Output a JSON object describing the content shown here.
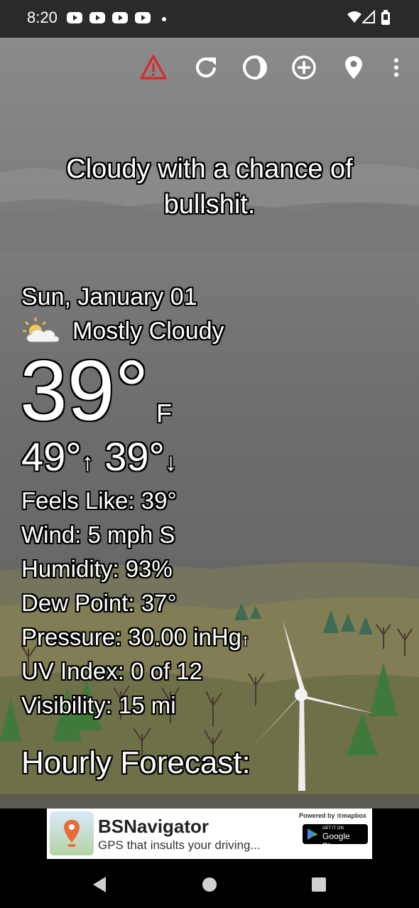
{
  "status_bar": {
    "time": "8:20",
    "notifications": [
      "youtube-icon",
      "youtube-icon",
      "youtube-icon",
      "youtube-icon"
    ],
    "system_icons": [
      "wifi-icon",
      "signal-icon",
      "battery-icon"
    ]
  },
  "toolbar": {
    "icons": [
      "warning-icon",
      "refresh-icon",
      "theme-icon",
      "add-location-icon",
      "location-pin-icon",
      "more-vert-icon"
    ],
    "warning_color": "#d32f2f"
  },
  "weather": {
    "tagline": "Cloudy with a chance of bullshit.",
    "date": "Sun, January 01",
    "condition": "Mostly Cloudy",
    "condition_icon": "partly-cloudy-icon",
    "temperature": "39°",
    "unit": "F",
    "high": "49°",
    "high_arrow": "↑",
    "low": "39°",
    "low_arrow": "↓",
    "details": {
      "feels_like": "Feels Like:  39°",
      "wind": "Wind:  5 mph S",
      "humidity": "Humidity:  93%",
      "dew_point": "Dew Point:  37°",
      "pressure": "Pressure:  30.00 inHg",
      "pressure_arrow": "↑",
      "uv_index": "UV Index:  0 of 12",
      "visibility": "Visibility:  15 mi"
    },
    "hourly_heading": "Hourly Forecast:"
  },
  "ad": {
    "title": "BSNavigator",
    "subtitle": "GPS that insults your driving...",
    "powered_by": "Powered by ⊙mapbox",
    "store_small": "GET IT ON",
    "store_name": "Google Play"
  },
  "nav_bar": {
    "icons": [
      "back-icon",
      "home-icon",
      "recents-icon"
    ]
  }
}
